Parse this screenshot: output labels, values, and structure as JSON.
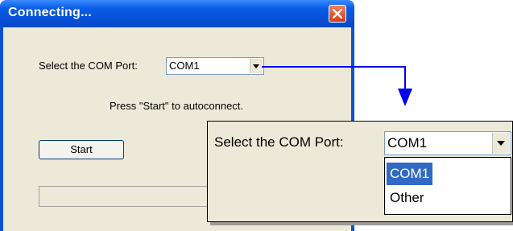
{
  "dialog": {
    "title": "Connecting...",
    "com_port_label": "Select the COM Port:",
    "com_port_value": "COM1",
    "instruction": "Press \"Start\" to autoconnect.",
    "start_label": "Start",
    "progress": 0
  },
  "callout": {
    "com_port_label": "Select the COM Port:",
    "com_port_value": "COM1",
    "options": [
      "COM1",
      "Other"
    ],
    "selected_option": "COM1"
  },
  "colors": {
    "titlebar": "#0a5ce8",
    "window_bg": "#ece9d8",
    "arrow": "#0000ee",
    "selection": "#316ac5",
    "close_button": "#d43c16"
  },
  "icons": {
    "close": "close-icon",
    "dropdown": "chevron-down-icon"
  }
}
